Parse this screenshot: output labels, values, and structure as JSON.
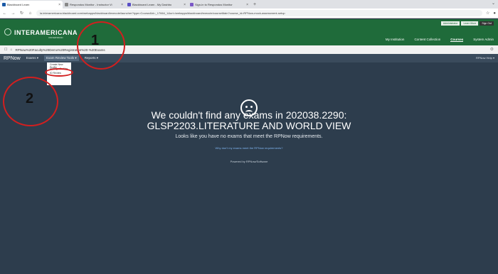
{
  "browser": {
    "tabs": [
      {
        "title": "Blackboard Learn",
        "color": "#1b5aa6",
        "active": true
      },
      {
        "title": "Respondus Monitor - Instructor Vi",
        "color": "#888888",
        "active": false
      },
      {
        "title": "Blackboard Learn - My Dashbo",
        "color": "#5a4fc6",
        "active": false
      },
      {
        "title": "Sign-in to Respondus Monitor",
        "color": "#7b58c7",
        "active": false
      }
    ],
    "new_tab": "+",
    "url": "la.interamericana.blackboard.com/webapps/blackboard/execute/launcher?type=Course&id=_17664_1&url=/webapps/blackboard/execute/courseMain?course_id=RPNow-mock-assessment-setup"
  },
  "site": {
    "logo": "INTERAMERICANA",
    "logo_sub": "UNIVERSIDAD",
    "util_buttons": [
      "Administrator",
      "Learn More",
      "Sign Out"
    ],
    "topnav": [
      "My Institution",
      "Content Collection",
      "Courses",
      "System Admin"
    ],
    "topnav_selected": 2
  },
  "breadcrumb": {
    "text": "RPNow%20Faculty%20Demo%20Registration%20-%20Exams"
  },
  "appnav": {
    "brand": "RPNow",
    "items": [
      "Exams ▾",
      "Exam Review Tools ▾",
      "Reports ▾"
    ],
    "right": "RPNow Help ▾"
  },
  "dropdown": {
    "items": [
      "Create New Profile",
      "Manage Profiles",
      "ID Review"
    ]
  },
  "annotations": [
    "1",
    "2"
  ],
  "message": {
    "title_line1": "We couldn't find any exams in 202038.2290:",
    "title_line2": "GLSP2203.LITERATURE AND WORLD VIEW",
    "subtitle": "Looks like you have no exams that meet the RPNow requirements.",
    "link": "Why don't my exams meet the RPNow requirements?",
    "powered": "Powered by RPNow/Software"
  }
}
